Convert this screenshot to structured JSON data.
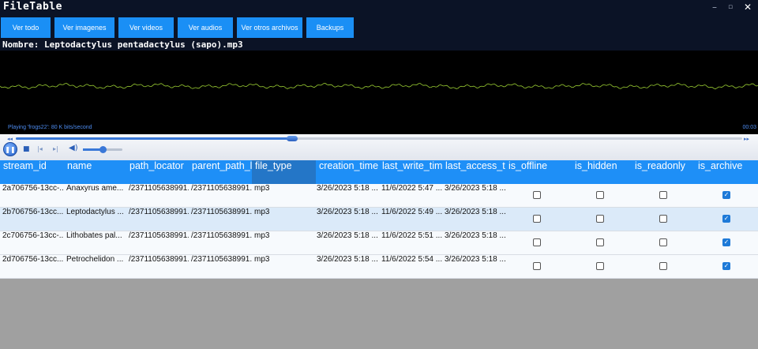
{
  "app": {
    "title": "FileTable"
  },
  "window": {
    "minimize": "–",
    "restore": "▫",
    "close": "✕"
  },
  "nav": [
    {
      "label": "Ver todo"
    },
    {
      "label": "Ver imagenes"
    },
    {
      "label": "Ver videos"
    },
    {
      "label": "Ver audios"
    },
    {
      "label": "Ver otros archivos"
    },
    {
      "label": "Backups"
    }
  ],
  "file": {
    "name": "Nombre: Leptodactylus pentadactylus (sapo).mp3"
  },
  "player": {
    "status": "Playing 'frogs22': 80 K bits/second",
    "time": "00:03",
    "progress": 0.38,
    "volume": 0.5,
    "waveform_color": "#9acd32"
  },
  "table": {
    "columns": [
      "stream_id",
      "name",
      "path_locator",
      "parent_path_l",
      "file_type",
      "creation_time",
      "last_write_tim",
      "last_access_ti",
      "is_offline",
      "is_hidden",
      "is_readonly",
      "is_archive"
    ],
    "rows": [
      {
        "stream_id": "2a706756-13cc-...",
        "name": "Anaxyrus ame...",
        "path_locator": "/2371105638991...",
        "parent_path": "/2371105638991...",
        "file_type": "mp3",
        "creation_time": "3/26/2023 5:18 ...",
        "last_write_time": "11/6/2022 5:47 ...",
        "last_access_time": "3/26/2023 5:18 ...",
        "is_offline": false,
        "is_hidden": false,
        "is_readonly": false,
        "is_archive": true
      },
      {
        "stream_id": "2b706756-13cc...",
        "name": "Leptodactylus ...",
        "path_locator": "/2371105638991...",
        "parent_path": "/2371105638991...",
        "file_type": "mp3",
        "creation_time": "3/26/2023 5:18 ...",
        "last_write_time": "11/6/2022 5:49 ...",
        "last_access_time": "3/26/2023 5:18 ...",
        "is_offline": false,
        "is_hidden": false,
        "is_readonly": false,
        "is_archive": true
      },
      {
        "stream_id": "2c706756-13cc-...",
        "name": "Lithobates pal...",
        "path_locator": "/2371105638991...",
        "parent_path": "/2371105638991...",
        "file_type": "mp3",
        "creation_time": "3/26/2023 5:18 ...",
        "last_write_time": "11/6/2022 5:51 ...",
        "last_access_time": "3/26/2023 5:18 ...",
        "is_offline": false,
        "is_hidden": false,
        "is_readonly": false,
        "is_archive": true
      },
      {
        "stream_id": "2d706756-13cc...",
        "name": "Petrochelidon ...",
        "path_locator": "/2371105638991...",
        "parent_path": "/2371105638991...",
        "file_type": "mp3",
        "creation_time": "3/26/2023 5:18 ...",
        "last_write_time": "11/6/2022 5:54 ...",
        "last_access_time": "3/26/2023 5:18 ...",
        "is_offline": false,
        "is_hidden": false,
        "is_readonly": false,
        "is_archive": true
      }
    ],
    "selected_row": 1,
    "active_column": 4
  },
  "colors": {
    "accent": "#1e8ff7",
    "selected_row": "#dbeaf9",
    "titlebar": "#0b1326"
  }
}
